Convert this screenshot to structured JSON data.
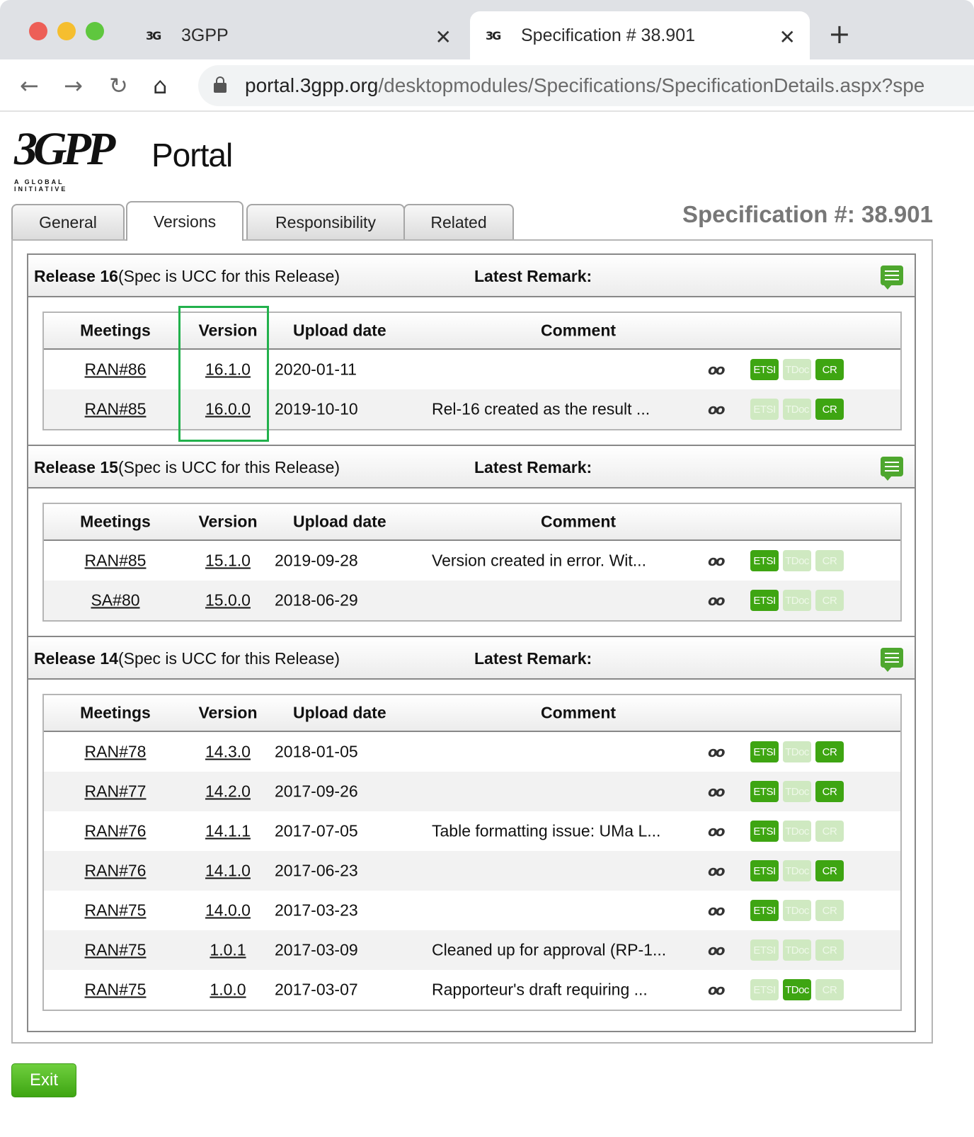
{
  "browser": {
    "tabs": [
      {
        "title": "3GPP"
      },
      {
        "title": "Specification # 38.901"
      }
    ],
    "url_host": "portal.3gpp.org",
    "url_path": "/desktopmodules/Specifications/SpecificationDetails.aspx?spe"
  },
  "logo": {
    "text": "3GPP",
    "subtitle": "A GLOBAL INITIATIVE",
    "portal": "Portal"
  },
  "page_tabs": [
    "General",
    "Versions",
    "Responsibility",
    "Related"
  ],
  "active_tab": "Versions",
  "spec_title": "Specification #: 38.901",
  "table_headers": {
    "meetings": "Meetings",
    "version": "Version",
    "upload_date": "Upload date",
    "comment": "Comment"
  },
  "releases": [
    {
      "name": "Release 16",
      "note": "(Spec is UCC for this Release)",
      "remark_label": "Latest Remark:",
      "rows": [
        {
          "meeting": "RAN#86",
          "version": "16.1.0",
          "date": "2020-01-11",
          "comment": "",
          "etsi": true,
          "tdoc": false,
          "cr": true
        },
        {
          "meeting": "RAN#85",
          "version": "16.0.0",
          "date": "2019-10-10",
          "comment": "Rel-16 created as the result ...",
          "etsi": false,
          "tdoc": false,
          "cr": true
        }
      ]
    },
    {
      "name": "Release 15",
      "note": "(Spec is UCC for this Release)",
      "remark_label": "Latest Remark:",
      "rows": [
        {
          "meeting": "RAN#85",
          "version": "15.1.0",
          "date": "2019-09-28",
          "comment": "Version created in error. Wit...",
          "etsi": true,
          "tdoc": false,
          "cr": false
        },
        {
          "meeting": "SA#80",
          "version": "15.0.0",
          "date": "2018-06-29",
          "comment": "",
          "etsi": true,
          "tdoc": false,
          "cr": false
        }
      ]
    },
    {
      "name": "Release 14",
      "note": "(Spec is UCC for this Release)",
      "remark_label": "Latest Remark:",
      "rows": [
        {
          "meeting": "RAN#78",
          "version": "14.3.0",
          "date": "2018-01-05",
          "comment": "",
          "etsi": true,
          "tdoc": false,
          "cr": true
        },
        {
          "meeting": "RAN#77",
          "version": "14.2.0",
          "date": "2017-09-26",
          "comment": "",
          "etsi": true,
          "tdoc": false,
          "cr": true
        },
        {
          "meeting": "RAN#76",
          "version": "14.1.1",
          "date": "2017-07-05",
          "comment": "Table formatting issue: UMa L...",
          "etsi": true,
          "tdoc": false,
          "cr": false
        },
        {
          "meeting": "RAN#76",
          "version": "14.1.0",
          "date": "2017-06-23",
          "comment": "",
          "etsi": true,
          "tdoc": false,
          "cr": true
        },
        {
          "meeting": "RAN#75",
          "version": "14.0.0",
          "date": "2017-03-23",
          "comment": "",
          "etsi": true,
          "tdoc": false,
          "cr": false
        },
        {
          "meeting": "RAN#75",
          "version": "1.0.1",
          "date": "2017-03-09",
          "comment": "Cleaned up for approval (RP-1...",
          "etsi": false,
          "tdoc": false,
          "cr": false
        },
        {
          "meeting": "RAN#75",
          "version": "1.0.0",
          "date": "2017-03-07",
          "comment": "Rapporteur's draft requiring ...",
          "etsi": false,
          "tdoc": true,
          "cr": false
        }
      ]
    }
  ],
  "badges": {
    "etsi": "ETSI",
    "tdoc": "TDoc",
    "cr": "CR"
  },
  "glasses_icon": "glasses-icon",
  "exit_label": "Exit",
  "colors": {
    "badge_on": "#3ea512",
    "badge_off": "#cfe9c1",
    "highlight": "#22b14c",
    "spec_title": "#777777"
  }
}
